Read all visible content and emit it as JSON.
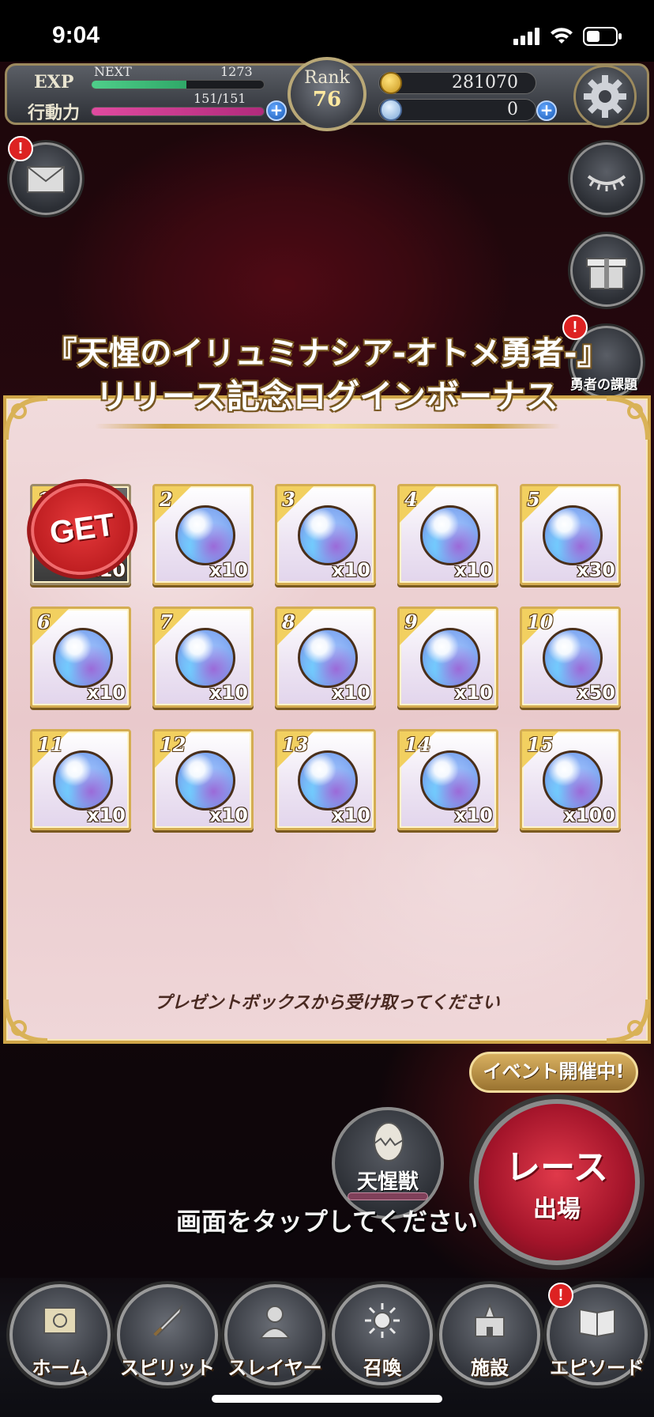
{
  "status_bar": {
    "time": "9:04"
  },
  "hud": {
    "exp_label": "EXP",
    "next_label": "NEXT",
    "next_value": "1273",
    "exp_fill": 0.55,
    "stamina_label": "行動力",
    "stamina_value": "151/151",
    "stamina_fill": 1.0,
    "rank_label": "Rank",
    "rank_value": "76",
    "gold_value": "281070",
    "gem_value": "0",
    "plus": "+"
  },
  "side_buttons": {
    "mail_badge": "!",
    "task_badge": "!",
    "task_label": "勇者の課題"
  },
  "dialog": {
    "title_line1": "『天惺のイリュミナシア-オトメ勇者-』",
    "title_line2": "リリース記念ログインボーナス",
    "get_stamp": "GET",
    "footer": "プレゼントボックスから受け取ってください"
  },
  "rewards": [
    {
      "day": "1",
      "qty": "x10",
      "claimed": true
    },
    {
      "day": "2",
      "qty": "x10"
    },
    {
      "day": "3",
      "qty": "x10"
    },
    {
      "day": "4",
      "qty": "x10"
    },
    {
      "day": "5",
      "qty": "x30"
    },
    {
      "day": "6",
      "qty": "x10"
    },
    {
      "day": "7",
      "qty": "x10"
    },
    {
      "day": "8",
      "qty": "x10"
    },
    {
      "day": "9",
      "qty": "x10"
    },
    {
      "day": "10",
      "qty": "x50"
    },
    {
      "day": "11",
      "qty": "x10"
    },
    {
      "day": "12",
      "qty": "x10"
    },
    {
      "day": "13",
      "qty": "x10"
    },
    {
      "day": "14",
      "qty": "x10"
    },
    {
      "day": "15",
      "qty": "x100"
    }
  ],
  "lower": {
    "event_banner": "イベント開催中!",
    "race_line1": "レース",
    "race_line2": "出場",
    "beast_label": "天惺獣",
    "tap_prompt": "画面をタップしてください"
  },
  "nav": {
    "items": [
      {
        "label": "ホーム"
      },
      {
        "label": "スピリット"
      },
      {
        "label": "スレイヤー"
      },
      {
        "label": "召喚"
      },
      {
        "label": "施設"
      },
      {
        "label": "エピソード"
      }
    ],
    "episode_badge": "!"
  }
}
